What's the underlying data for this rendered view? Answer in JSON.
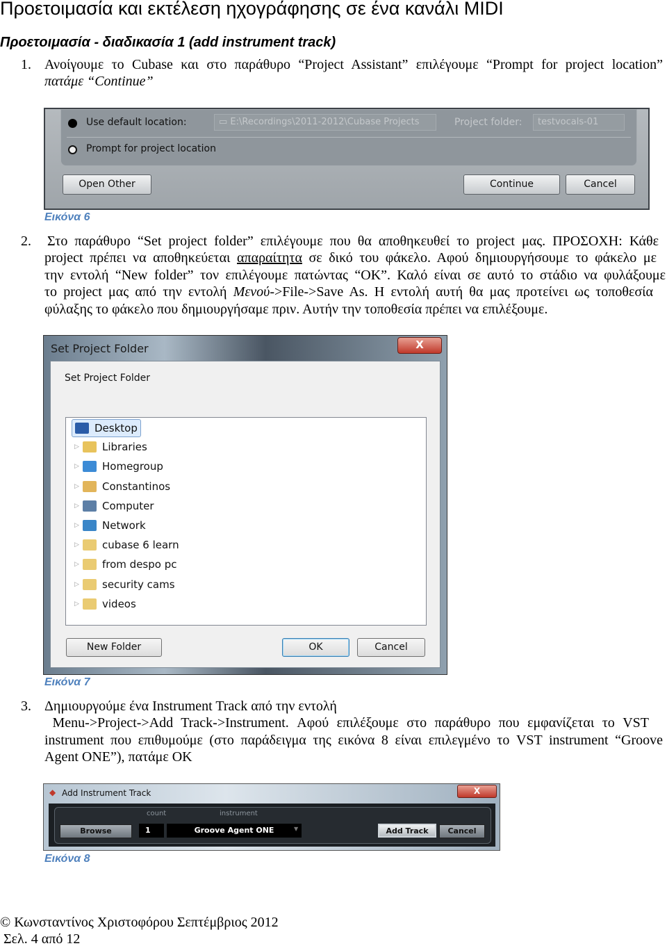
{
  "title": "Προετοιμασία και εκτέλεση ηχογράφησης σε ένα κανάλι MIDI",
  "subtitle": "Προετοιμασία - διαδικασία 1 (add instrument track)",
  "step1": {
    "num": "1.",
    "lines": [
      "Ανοίγουμε το Cubase και στο παράθυρο “Project Assistant” επιλέγουμε “Prompt for project location”",
      "πατάμε “Continue”"
    ]
  },
  "figure6": {
    "use_default_label": "Use default location:",
    "default_path": "E:\\Recordings\\2011-2012\\Cubase Projects",
    "project_folder_label": "Project folder:",
    "project_folder_value": "testvocals-01",
    "prompt_label": "Prompt for project location",
    "open_other": "Open Other",
    "continue": "Continue",
    "cancel": "Cancel",
    "caption": "Εικόνα 6"
  },
  "step2": {
    "num": "2.",
    "lines": [
      "Στο παράθυρο “Set project folder” επιλέγουμε που θα αποθηκευθεί το project μας. ΠΡΟΣΟΧΗ: Κάθε"
    ],
    "line2_a": "project πρέπει να αποθηκεύεται ",
    "line2_u": "απαραίτητα",
    "line2_b": " σε δικό του φάκελο. Αφού δημιουργήσουμε το φάκελο με",
    "line3": "την εντολή “New folder” τον επιλέγουμε πατώντας “OK”. Καλό είναι σε αυτό το στάδιο να φυλάξουμε",
    "line4_a": "το project μας από την εντολή ",
    "line4_i": "Μενού",
    "line4_b": "->File->Save As. Η εντολή αυτή θα μας προτείνει ως τοποθεσία",
    "line5": "φύλαξης το φάκελο που δημιουργήσαμε πριν. Αυτήν την τοποθεσία πρέπει να επιλέξουμε."
  },
  "figure7": {
    "window_title": "Set Project Folder",
    "close": "X",
    "heading": "Set Project Folder",
    "tree": [
      {
        "label": "Desktop",
        "icon": "desktop-icon",
        "selected": true
      },
      {
        "label": "Libraries",
        "icon": "libraries-icon"
      },
      {
        "label": "Homegroup",
        "icon": "homegroup-icon"
      },
      {
        "label": "Constantinos",
        "icon": "user-folder-icon"
      },
      {
        "label": "Computer",
        "icon": "computer-icon"
      },
      {
        "label": "Network",
        "icon": "network-icon"
      },
      {
        "label": "cubase 6 learn",
        "icon": "folder-icon"
      },
      {
        "label": "from despo pc",
        "icon": "folder-icon"
      },
      {
        "label": "security cams",
        "icon": "folder-icon"
      },
      {
        "label": "videos",
        "icon": "folder-icon"
      }
    ],
    "new_folder": "New Folder",
    "ok": "OK",
    "cancel": "Cancel",
    "caption": "Εικόνα 7"
  },
  "step3": {
    "num": "3.",
    "lines": [
      "Δημιουργούμε ένα Instrument Track από την εντολή",
      " Menu->Project->Add Track->Instrument. Αφού επιλέξουμε στο παράθυρο που εμφανίζεται το VST",
      "instrument που επιθυμούμε (στο παράδειγμα της εικόνα 8 είναι επιλεγμένο το VST instrument “Groove",
      "Agent ONE”), πατάμε OK"
    ]
  },
  "figure8": {
    "window_title": "Add Instrument Track",
    "close": "X",
    "count_label": "count",
    "instrument_label": "instrument",
    "browse": "Browse",
    "count": "1",
    "instrument": "Groove Agent ONE",
    "add_track": "Add Track",
    "cancel": "Cancel",
    "caption": "Εικόνα 8"
  },
  "footer": {
    "author": "© Κωνσταντίνος Χριστοφόρου Σεπτέμβριος  2012",
    "page": " Σελ. 4 από 12"
  }
}
